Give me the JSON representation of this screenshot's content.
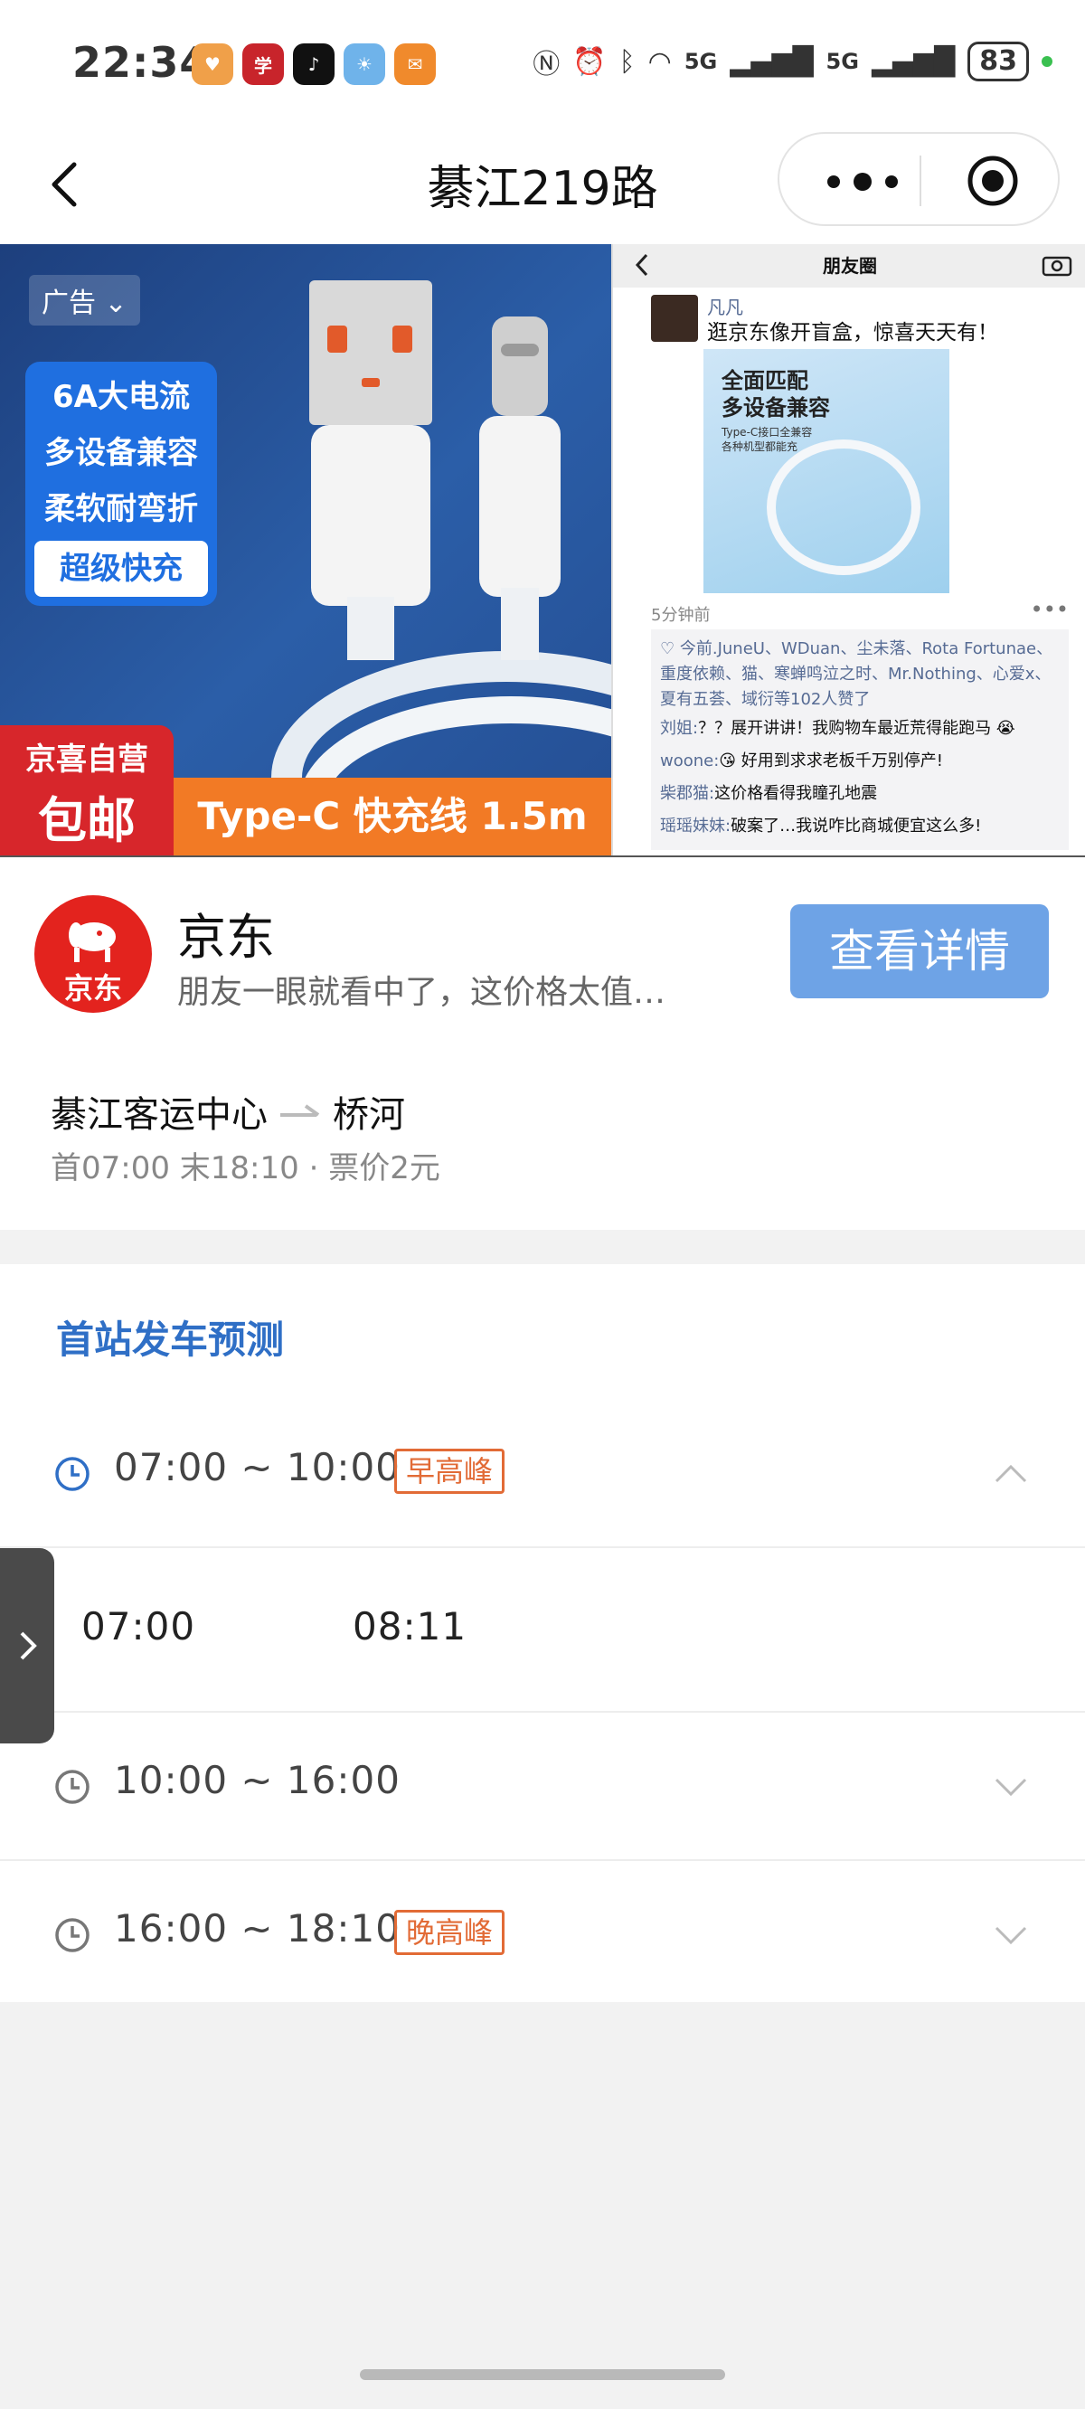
{
  "status_bar": {
    "time": "22:34",
    "app_icons": [
      {
        "name": "heart-app-icon",
        "color": "#f0a049",
        "glyph": "♥"
      },
      {
        "name": "xuexi-app-icon",
        "color": "#c8242b",
        "glyph": "学"
      },
      {
        "name": "tiktok-app-icon",
        "color": "#111111",
        "glyph": "♪"
      },
      {
        "name": "weather-app-icon",
        "color": "#6fb3ea",
        "glyph": "☀"
      },
      {
        "name": "mail-app-icon",
        "color": "#f08a2c",
        "glyph": "✉"
      }
    ],
    "network_label_1": "5G",
    "network_label_2": "5G",
    "battery": "83"
  },
  "nav": {
    "title": "綦江219路"
  },
  "ad": {
    "tag": "广告",
    "features": [
      "6A大电流",
      "多设备兼容",
      "柔软耐弯折",
      "超级快充"
    ],
    "self_operated": "京喜自营",
    "free_shipping": "包邮",
    "product": "Type-C 快充线 1.5m",
    "moments": {
      "header": "朋友圈",
      "poster_name": "凡凡",
      "post_text": "逛京东像开盲盒，惊喜天天有！",
      "image_title": "全面匹配\n多设备兼容",
      "image_sub": "Type-C接口全兼容\n各种机型都能充",
      "time_ago": "5分钟前",
      "likes": "今前.JuneU、WDuan、尘未落、Rota Fortunae、重度依赖、猫、寒蝉鸣泣之时、Mr.Nothing、心爱x、夏有五荟、域衍等102人赞了",
      "comments": [
        {
          "who": "刘姐:",
          "text": "？？展开讲讲！我购物车最近荒得能跑马 😭"
        },
        {
          "who": "woone:",
          "text": "😘 好用到求求老板千万别停产!"
        },
        {
          "who": "柴郡猫:",
          "text": "这价格看得我瞳孔地震"
        },
        {
          "who": "瑶瑶妹妹:",
          "text": "破案了…我说咋比商城便宜这么多!"
        }
      ]
    },
    "advertiser": "京东",
    "advertiser_logo_text": "京东",
    "description": "朋友一眼就看中了，这价格太值…",
    "cta": "查看详情"
  },
  "route": {
    "from": "綦江客运中心",
    "to": "桥河",
    "meta": "首07:00 末18:10 · 票价2元"
  },
  "prediction": {
    "title": "首站发车预测",
    "periods": [
      {
        "time": "07:00 ~ 10:00",
        "badge": "早高峰",
        "expanded": true
      },
      {
        "time": "10:00 ~ 16:00",
        "badge": "",
        "expanded": false
      },
      {
        "time": "16:00 ~ 18:10",
        "badge": "晚高峰",
        "expanded": false
      }
    ],
    "departures": [
      "07:00",
      "08:11"
    ]
  },
  "colors": {
    "accent_blue": "#2f6fc6",
    "peak_orange": "#e26b36",
    "cta_blue": "#6ea3e6",
    "jd_red": "#e3231e"
  }
}
